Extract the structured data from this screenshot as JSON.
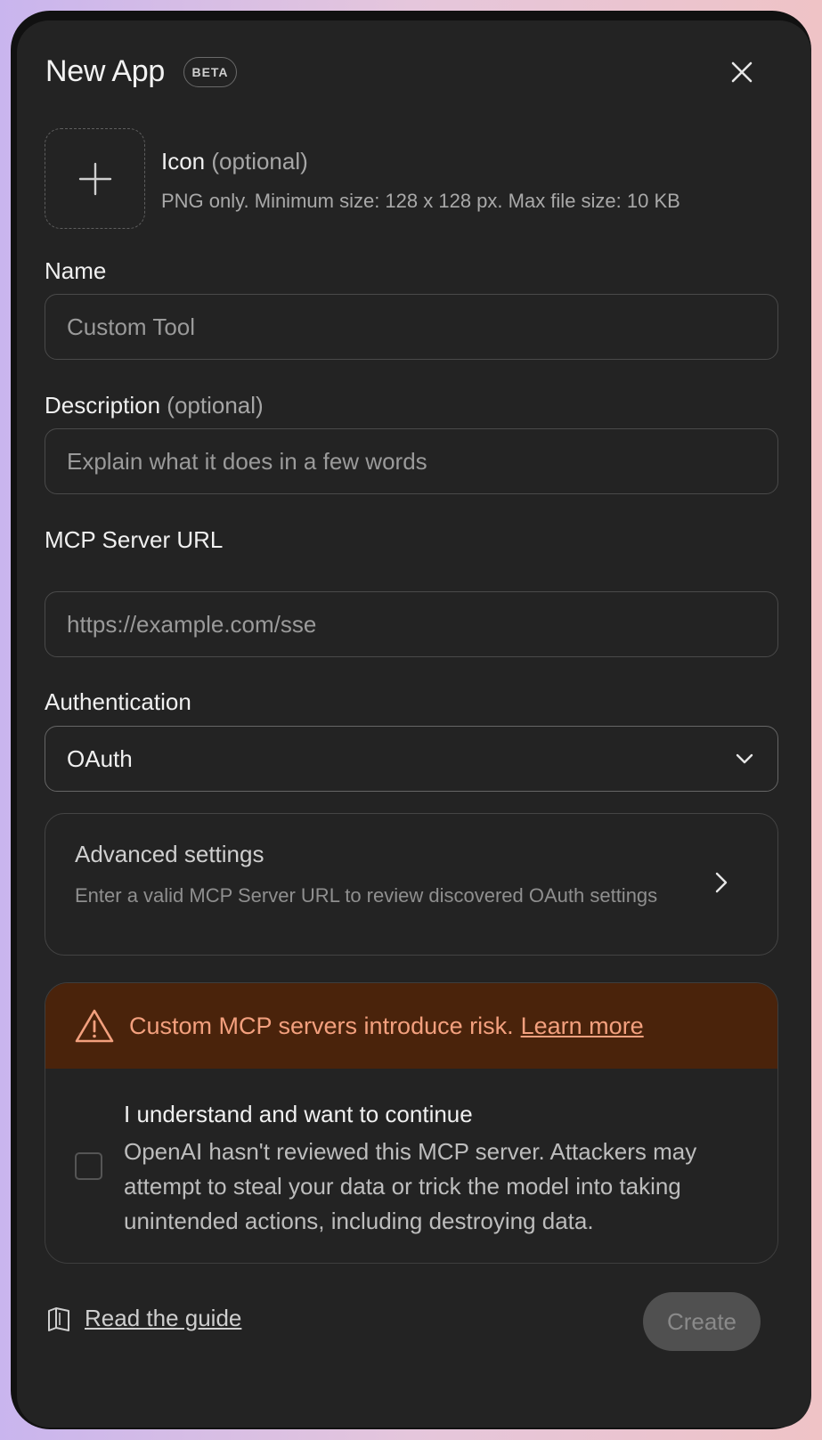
{
  "modal": {
    "title": "New App",
    "badge": "BETA"
  },
  "icon": {
    "label": "Icon",
    "optional": "(optional)",
    "hint": "PNG only. Minimum size: 128 x 128 px. Max file size: 10 KB"
  },
  "name": {
    "label": "Name",
    "placeholder": "Custom Tool"
  },
  "description": {
    "label": "Description",
    "optional": "(optional)",
    "placeholder": "Explain what it does in a few words"
  },
  "mcp": {
    "label": "MCP Server URL",
    "placeholder": "https://example.com/sse"
  },
  "auth": {
    "label": "Authentication",
    "value": "OAuth"
  },
  "advanced": {
    "title": "Advanced settings",
    "description": "Enter a valid MCP Server URL to review discovered OAuth settings"
  },
  "risk": {
    "warning": "Custom MCP servers introduce risk.",
    "link": "Learn more"
  },
  "consent": {
    "title": "I understand and want to continue",
    "body": "OpenAI hasn't reviewed this MCP server. Attackers may attempt to steal your data or trick the model into taking unintended actions, including destroying data."
  },
  "footer": {
    "guide": "Read the guide",
    "create": "Create"
  }
}
